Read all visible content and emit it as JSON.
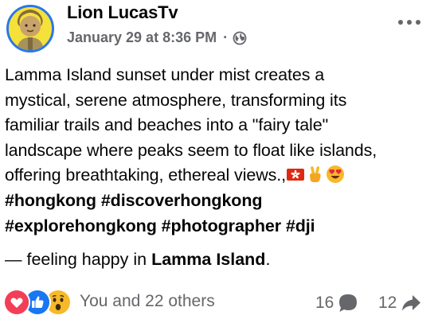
{
  "post": {
    "author": "Lion LucasTv",
    "timestamp": "January 29 at 8:36 PM",
    "separator": "·",
    "audience_icon": "globe-icon",
    "more_icon": "more-horizontal-icon",
    "body_lines": [
      "Lamma Island sunset under mist creates a",
      "mystical, serene atmosphere, transforming its",
      "familiar trails and beaches into a \"fairy tale\"",
      "landscape where peaks seem to float like islands,",
      "offering breathtaking, ethereal views.,"
    ],
    "emojis": [
      "hong-kong-flag-emoji",
      "victory-hand-emoji",
      "heart-eyes-emoji"
    ],
    "hashtags_line1": "#hongkong #discoverhongkong",
    "hashtags_line2": "#explorehongkong #photographer #dji",
    "feeling_prefix": "— feeling happy in ",
    "feeling_place": "Lamma Island",
    "feeling_suffix": "."
  },
  "footer": {
    "reaction_icons": [
      "love-reaction-icon",
      "like-reaction-icon",
      "wow-reaction-icon"
    ],
    "reactions_label": "You and 22 others",
    "comments_count": "16",
    "comments_icon": "comment-icon",
    "shares_count": "12",
    "shares_icon": "share-icon"
  },
  "colors": {
    "text": "#050505",
    "secondary": "#65676b",
    "like_blue": "#1877f2",
    "love_red": "#f33e58",
    "wow_yellow": "#f7b928"
  }
}
